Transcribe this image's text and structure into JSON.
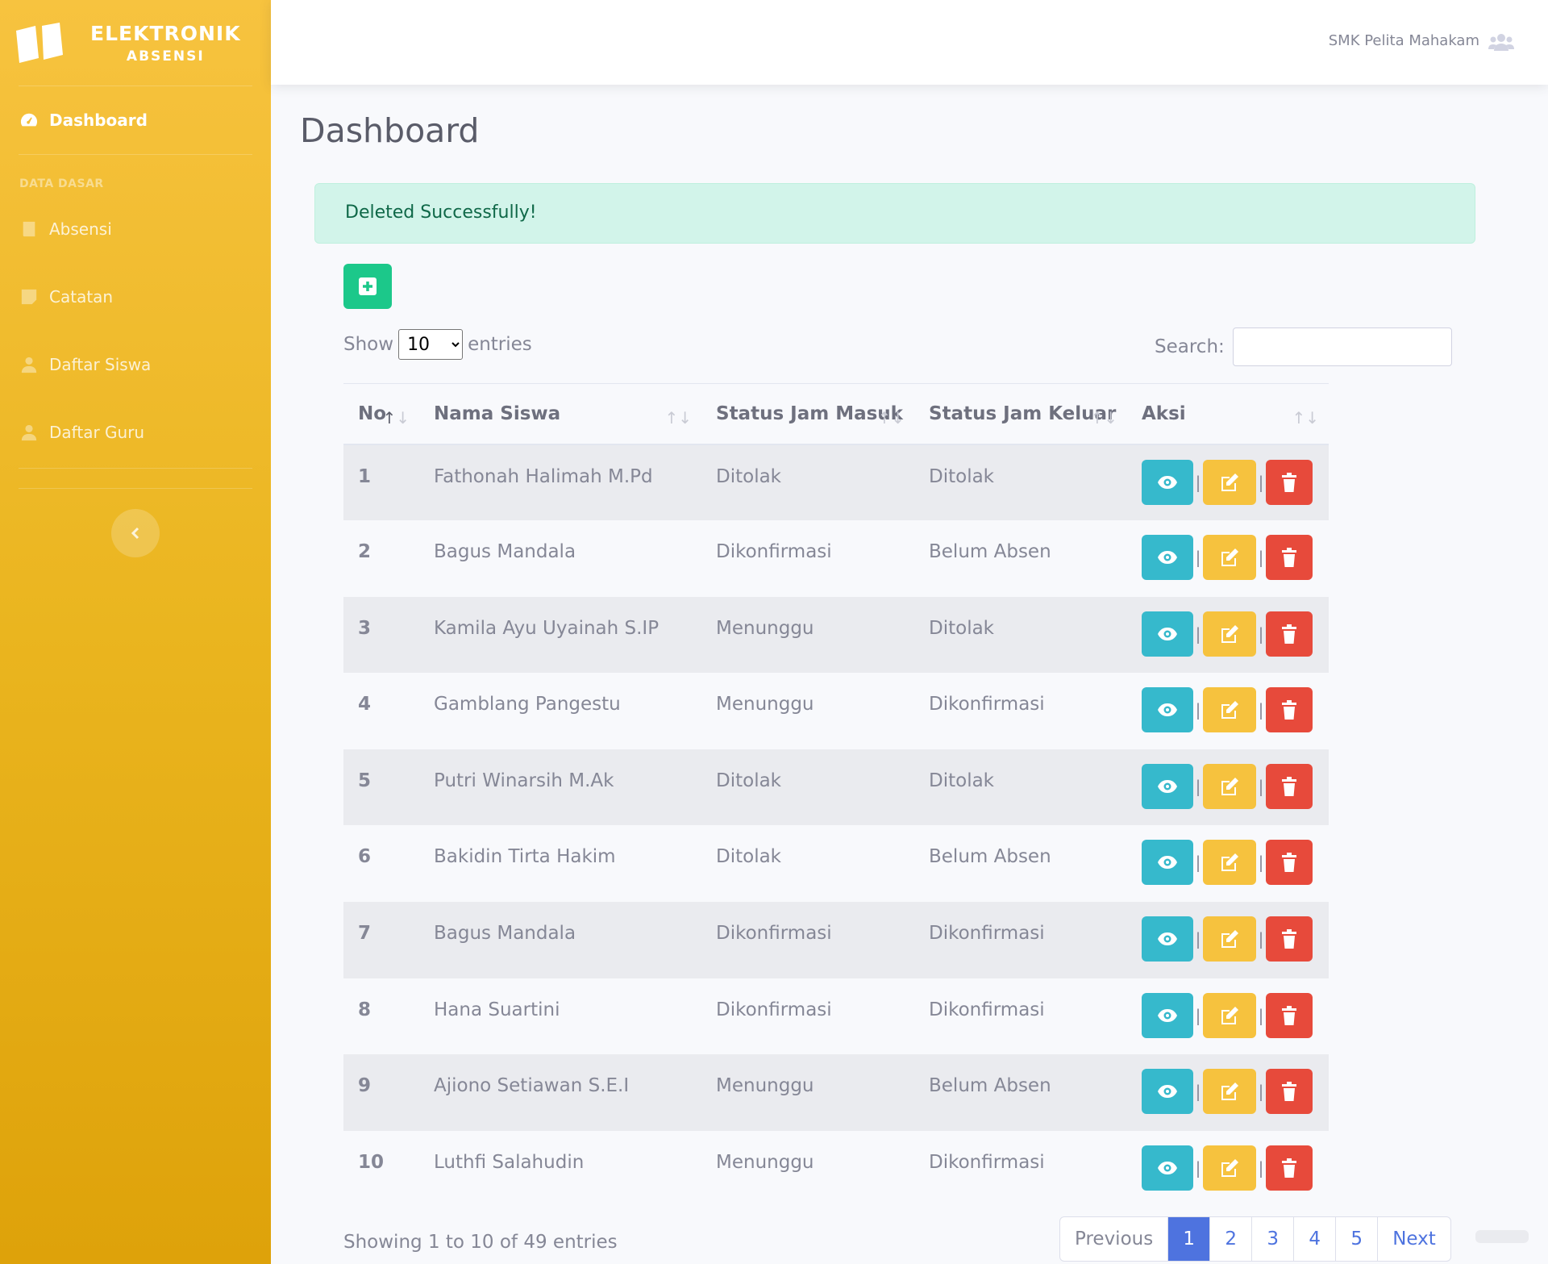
{
  "brand": {
    "title": "ELEKTRONIK",
    "subtitle": "ABSENSI"
  },
  "sidebar": {
    "dashboard": "Dashboard",
    "section": "DATA DASAR",
    "items": [
      "Absensi",
      "Catatan",
      "Daftar Siswa",
      "Daftar Guru"
    ]
  },
  "topbar": {
    "user": "SMK Pelita Mahakam"
  },
  "page": {
    "title": "Dashboard"
  },
  "alert": "Deleted Successfully!",
  "controls": {
    "show": "Show",
    "entries_value": "10",
    "entries": "entries",
    "search": "Search:"
  },
  "table": {
    "headers": [
      "No",
      "Nama Siswa",
      "Status Jam Masuk",
      "Status Jam Keluar",
      "Aksi"
    ],
    "rows": [
      {
        "no": "1",
        "nama": "Fathonah Halimah M.Pd",
        "masuk": "Ditolak",
        "keluar": "Ditolak"
      },
      {
        "no": "2",
        "nama": "Bagus Mandala",
        "masuk": "Dikonfirmasi",
        "keluar": "Belum Absen"
      },
      {
        "no": "3",
        "nama": "Kamila Ayu Uyainah S.IP",
        "masuk": "Menunggu",
        "keluar": "Ditolak"
      },
      {
        "no": "4",
        "nama": "Gamblang Pangestu",
        "masuk": "Menunggu",
        "keluar": "Dikonfirmasi"
      },
      {
        "no": "5",
        "nama": "Putri Winarsih M.Ak",
        "masuk": "Ditolak",
        "keluar": "Ditolak"
      },
      {
        "no": "6",
        "nama": "Bakidin Tirta Hakim",
        "masuk": "Ditolak",
        "keluar": "Belum Absen"
      },
      {
        "no": "7",
        "nama": "Bagus Mandala",
        "masuk": "Dikonfirmasi",
        "keluar": "Dikonfirmasi"
      },
      {
        "no": "8",
        "nama": "Hana Suartini",
        "masuk": "Dikonfirmasi",
        "keluar": "Dikonfirmasi"
      },
      {
        "no": "9",
        "nama": "Ajiono Setiawan S.E.I",
        "masuk": "Menunggu",
        "keluar": "Belum Absen"
      },
      {
        "no": "10",
        "nama": "Luthfi Salahudin",
        "masuk": "Menunggu",
        "keluar": "Dikonfirmasi"
      }
    ]
  },
  "footer": {
    "info": "Showing 1 to 10 of 49 entries",
    "pages": [
      "Previous",
      "1",
      "2",
      "3",
      "4",
      "5",
      "Next"
    ]
  },
  "colors": {
    "sidebar": "#f7c33f",
    "info": "#36b9cc",
    "warning": "#f6c23e",
    "danger": "#e74a3b",
    "success": "#1cc88a",
    "primary": "#4e73df"
  }
}
